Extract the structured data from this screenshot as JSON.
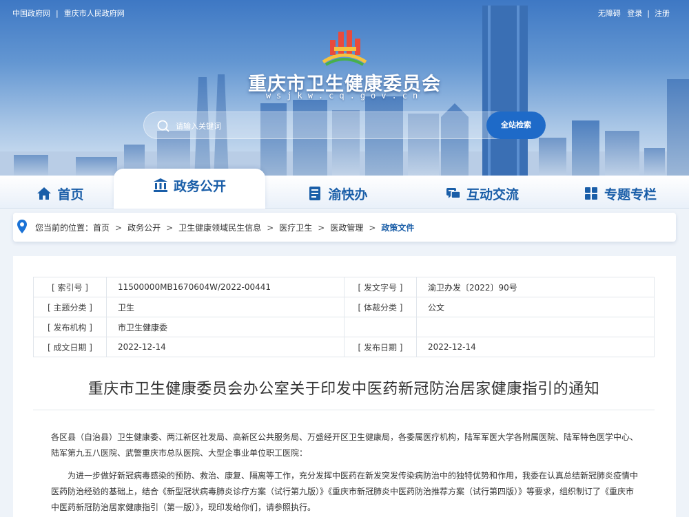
{
  "topbar": {
    "gov_link": "中国政府网",
    "city_link": "重庆市人民政府网",
    "accessibility": "无障碍",
    "login": "登录",
    "register": "注册",
    "divider": "|"
  },
  "header": {
    "title": "重庆市卫生健康委员会",
    "domain": "wsjkw.cq.gov.cn"
  },
  "search": {
    "placeholder": "请输入关键词",
    "button": "全站检索"
  },
  "nav": {
    "tabs": [
      {
        "label": "首页",
        "icon": "home-icon"
      },
      {
        "label": "政务公开",
        "icon": "government-building-icon"
      },
      {
        "label": "渝快办",
        "icon": "document-list-icon"
      },
      {
        "label": "互动交流",
        "icon": "chat-bubbles-icon"
      },
      {
        "label": "专题专栏",
        "icon": "grid-icon"
      }
    ],
    "active": "政务公开",
    "colors": {
      "accent": "#1a5ea8",
      "button": "#1e6ac8"
    }
  },
  "breadcrumb": {
    "prefix": "您当前的位置：",
    "items": [
      "首页",
      "政务公开",
      "卫生健康领域民生信息",
      "医疗卫生",
      "医政管理"
    ],
    "current": "政策文件",
    "separator": ">"
  },
  "meta": {
    "rows": [
      {
        "k1": "[ 索引号 ]",
        "v1": "11500000MB1670604W/2022-00441",
        "k2": "[ 发文字号 ]",
        "v2": "渝卫办发〔2022〕90号"
      },
      {
        "k1": "[ 主题分类 ]",
        "v1": "卫生",
        "k2": "[ 体裁分类 ]",
        "v2": "公文"
      },
      {
        "k1": "[ 发布机构 ]",
        "v1": "市卫生健康委",
        "k2": "",
        "v2": ""
      },
      {
        "k1": "[ 成文日期 ]",
        "v1": "2022-12-14",
        "k2": "[ 发布日期 ]",
        "v2": "2022-12-14"
      }
    ]
  },
  "document": {
    "title": "重庆市卫生健康委员会办公室关于印发中医药新冠防治居家健康指引的通知",
    "recipients": "各区县（自治县）卫生健康委、两江新区社发局、高新区公共服务局、万盛经开区卫生健康局，各委属医疗机构，陆军军医大学各附属医院、陆军特色医学中心、陆军第九五八医院、武警重庆市总队医院、大型企事业单位职工医院：",
    "para1": "为进一步做好新冠病毒感染的预防、救治、康复、隔离等工作，充分发挥中医药在新发突发传染病防治中的独特优势和作用，我委在认真总结新冠肺炎疫情中医药防治经验的基础上，结合《新型冠状病毒肺炎诊疗方案（试行第九版）》《重庆市新冠肺炎中医药防治推荐方案（试行第四版）》等要求，组织制订了《重庆市中医药新冠防治居家健康指引（第一版）》，现印发给你们，请参照执行。"
  }
}
